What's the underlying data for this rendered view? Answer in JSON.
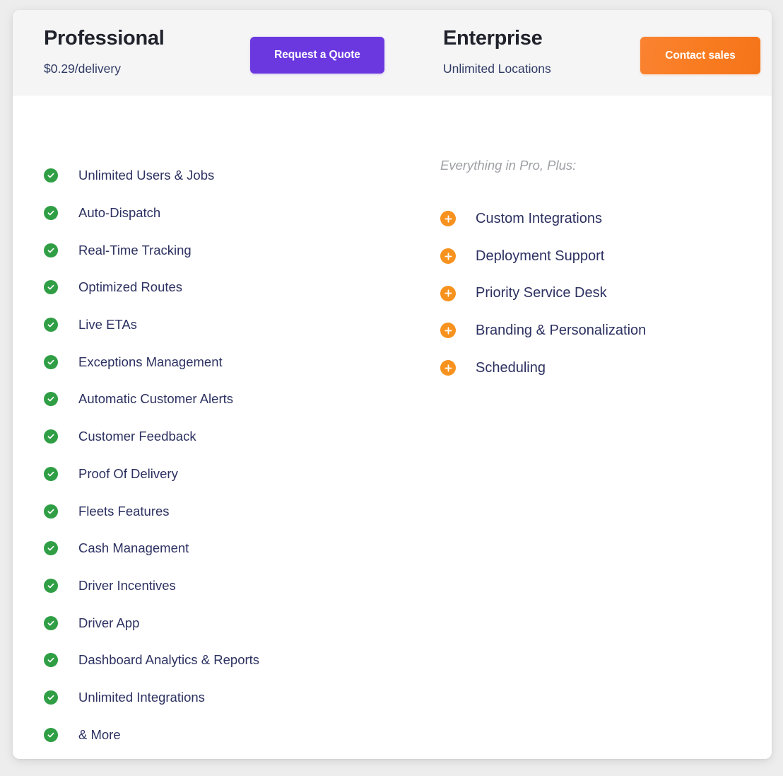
{
  "theme": {
    "page_background": "#ededee",
    "card_background": "#ffffff",
    "header_background": "#f5f5f6",
    "plan_title_color": "#21232c",
    "feature_text_color": "#2c3161",
    "note_color": "#9ea0a6",
    "check_badge_color": "#2f9e44",
    "plus_badge_color": "#f7921e",
    "quote_button_color": "#6b38e0",
    "sales_button_color": "#f97b20"
  },
  "plans": {
    "professional": {
      "name": "Professional",
      "subtitle": "$0.29/delivery",
      "cta_label": "Request a Quote",
      "check_icon": "check-circle-icon",
      "features": [
        "Unlimited Users & Jobs",
        "Auto-Dispatch",
        "Real-Time Tracking",
        "Optimized Routes",
        "Live ETAs",
        "Exceptions Management",
        "Automatic Customer Alerts",
        "Customer Feedback",
        "Proof Of Delivery",
        "Fleets Features",
        "Cash Management",
        "Driver Incentives",
        "Driver App",
        "Dashboard Analytics & Reports",
        "Unlimited Integrations",
        "& More"
      ]
    },
    "enterprise": {
      "name": "Enterprise",
      "subtitle": "Unlimited Locations",
      "cta_label": "Contact sales",
      "note": "Everything in Pro, Plus:",
      "plus_icon": "plus-circle-icon",
      "features": [
        "Custom Integrations",
        "Deployment Support",
        "Priority Service Desk",
        "Branding & Personalization",
        "Scheduling"
      ]
    }
  }
}
